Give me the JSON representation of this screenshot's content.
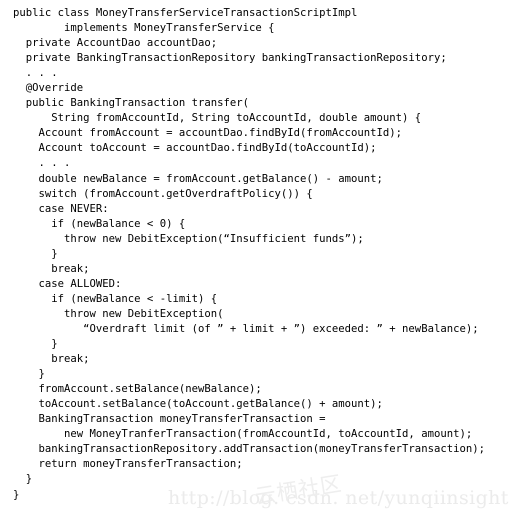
{
  "document": {
    "language": "java",
    "background_color": "#ffffff",
    "text_color": "#000000"
  },
  "code": {
    "lines": [
      "public class MoneyTransferServiceTransactionScriptImpl",
      "        implements MoneyTransferService {",
      "  private AccountDao accountDao;",
      "  private BankingTransactionRepository bankingTransactionRepository;",
      "  . . .",
      "  @Override",
      "  public BankingTransaction transfer(",
      "      String fromAccountId, String toAccountId, double amount) {",
      "    Account fromAccount = accountDao.findById(fromAccountId);",
      "    Account toAccount = accountDao.findById(toAccountId);",
      "    . . .",
      "    double newBalance = fromAccount.getBalance() - amount;",
      "    switch (fromAccount.getOverdraftPolicy()) {",
      "    case NEVER:",
      "      if (newBalance < 0) {",
      "        throw new DebitException(“Insufficient funds”);",
      "      }",
      "      break;",
      "    case ALLOWED:",
      "      if (newBalance < -limit) {",
      "        throw new DebitException(",
      "           “Overdraft limit (of ” + limit + ”) exceeded: ” + newBalance);",
      "      }",
      "      break;",
      "    }",
      "    fromAccount.setBalance(newBalance);",
      "    toAccount.setBalance(toAccount.getBalance() + amount);",
      "    BankingTransaction moneyTransferTransaction =",
      "        new MoneyTranferTransaction(fromAccountId, toAccountId, amount);",
      "    bankingTransactionRepository.addTransaction(moneyTransferTransaction);",
      "    return moneyTransferTransaction;",
      "  }",
      "}"
    ]
  },
  "watermark": {
    "url_text": "http://blog. csdn. net/yunqiinsight",
    "overlay_text": "云栖社区",
    "color": "#ebebeb"
  }
}
